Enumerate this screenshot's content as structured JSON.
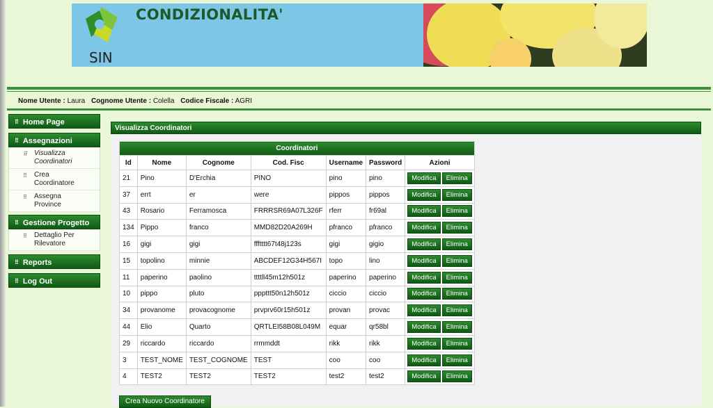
{
  "banner": {
    "logo_text": "SIN",
    "title": "CONDIZIONALITA'"
  },
  "user_info": {
    "nome_label": "Nome Utente :",
    "nome_value": "Laura",
    "cognome_label": "Cognome Utente :",
    "cognome_value": "Colella",
    "cf_label": "Codice Fiscale :",
    "cf_value": "AGRI"
  },
  "sidebar": {
    "home": "Home Page",
    "assegnazioni": "Assegnazioni",
    "visualizza_l1": "Visualizza",
    "visualizza_l2": "Coordinatori",
    "crea_l1": "Crea",
    "crea_l2": "Coordinatore",
    "assegna_l1": "Assegna",
    "assegna_l2": "Province",
    "gestione": "Gestione Progetto",
    "dettaglio_l1": "Dettaglio Per",
    "dettaglio_l2": "Rilevatore",
    "reports": "Reports",
    "logout": "Log Out"
  },
  "panel": {
    "title": "Visualizza Coordinatori"
  },
  "table": {
    "caption": "Coordinatori",
    "headers": [
      "Id",
      "Nome",
      "Cognome",
      "Cod. Fisc",
      "Username",
      "Password",
      "Azioni"
    ],
    "rows": [
      [
        "21",
        "Pino",
        "D'Erchia",
        "PINO",
        "pino",
        "pino"
      ],
      [
        "37",
        "errt",
        "er",
        "were",
        "pippos",
        "pippos"
      ],
      [
        "43",
        "Rosario",
        "Ferramosca",
        "FRRRSR69A07L326F",
        "rferr",
        "fr69al"
      ],
      [
        "134",
        "Pippo",
        "franco",
        "MMD82D20A269H",
        "pfranco",
        "pfranco"
      ],
      [
        "16",
        "gigi",
        "gigi",
        "ffftttt67t48j123s",
        "gigi",
        "gigio"
      ],
      [
        "15",
        "topolino",
        "minnie",
        "ABCDEF12G34H567I",
        "topo",
        "lino"
      ],
      [
        "11",
        "paperino",
        "paolino",
        "ttttll45m12h501z",
        "paperino",
        "paperino"
      ],
      [
        "10",
        "pippo",
        "pluto",
        "pppttt50n12h501z",
        "ciccio",
        "ciccio"
      ],
      [
        "34",
        "provanome",
        "provacognome",
        "prvprv60r15h501z",
        "provan",
        "provac"
      ],
      [
        "44",
        "Elio",
        "Quarto",
        "QRTLEI58B08L049M",
        "equar",
        "qr58bl"
      ],
      [
        "29",
        "riccardo",
        "riccardo",
        "rrmmddt",
        "rikk",
        "rikk"
      ],
      [
        "3",
        "TEST_NOME",
        "TEST_COGNOME",
        "TEST",
        "coo",
        "coo"
      ],
      [
        "4",
        "TEST2",
        "TEST2",
        "TEST2",
        "test2",
        "test2"
      ]
    ],
    "edit_label": "Modifica",
    "delete_label": "Elimina"
  },
  "new_button": "Crea Nuovo Coordinatore",
  "colors": {
    "accent_green": "#1a6e1e",
    "page_bg": "#eaf7d6",
    "banner_sky": "#7ec6e6"
  }
}
